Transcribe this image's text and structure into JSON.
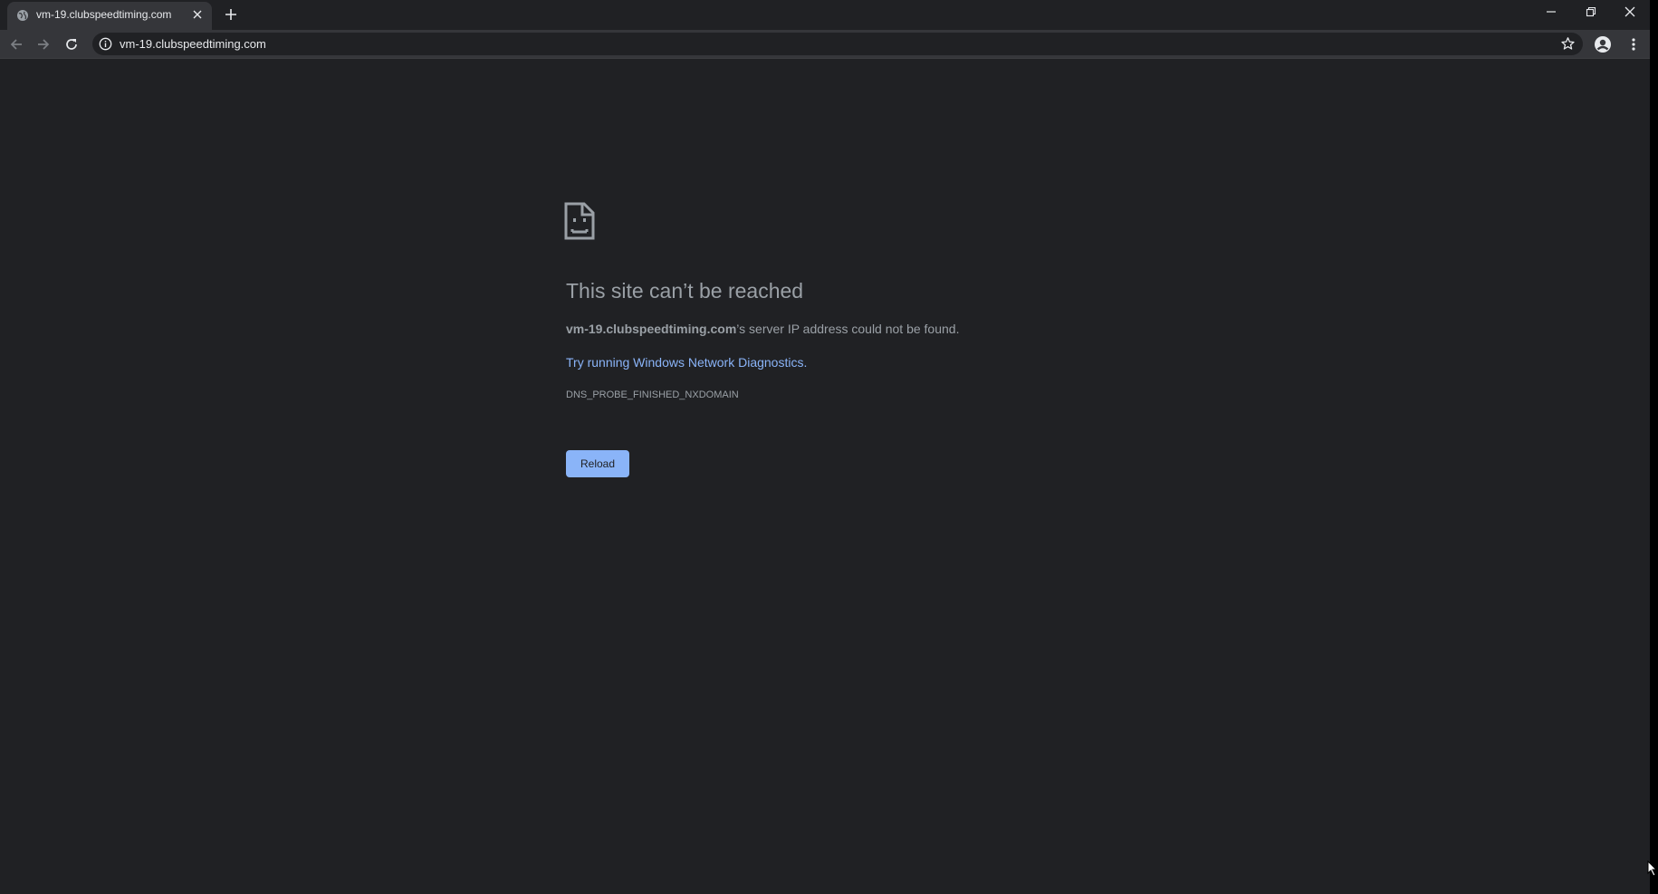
{
  "tab": {
    "title": "vm-19.clubspeedtiming.com",
    "favicon": "globe-icon"
  },
  "toolbar": {
    "url": "vm-19.clubspeedtiming.com"
  },
  "error": {
    "icon": "sad-page-icon",
    "title": "This site can’t be reached",
    "host": "vm-19.clubspeedtiming.com",
    "message_suffix": "’s server IP address could not be found.",
    "suggestion": "Try running Windows Network Diagnostics.",
    "code": "DNS_PROBE_FINISHED_NXDOMAIN",
    "reload_label": "Reload"
  },
  "colors": {
    "background": "#202124",
    "link": "#8ab4f8",
    "text": "#9aa0a6",
    "button": "#8ab4f8"
  }
}
